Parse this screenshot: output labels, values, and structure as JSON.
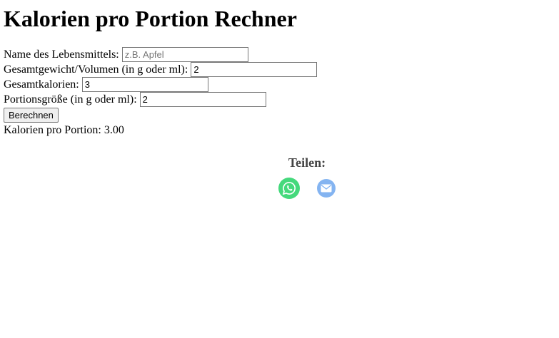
{
  "page": {
    "title": "Kalorien pro Portion Rechner"
  },
  "form": {
    "name": {
      "label": "Name des Lebensmittels:",
      "placeholder": "z.B. Apfel",
      "value": ""
    },
    "total_weight": {
      "label": "Gesamtgewicht/Volumen (in g oder ml):",
      "value": "2"
    },
    "total_calories": {
      "label": "Gesamtkalorien:",
      "value": "3"
    },
    "portion_size": {
      "label": "Portionsgröße (in g oder ml):",
      "value": "2"
    },
    "calculate_label": "Berechnen"
  },
  "result": {
    "text": "Kalorien pro Portion: 3.00"
  },
  "share": {
    "title": "Teilen:",
    "icons": [
      "whatsapp-icon",
      "email-icon"
    ],
    "colors": {
      "whatsapp": "#25d366",
      "email": "#6fa8ef"
    }
  }
}
